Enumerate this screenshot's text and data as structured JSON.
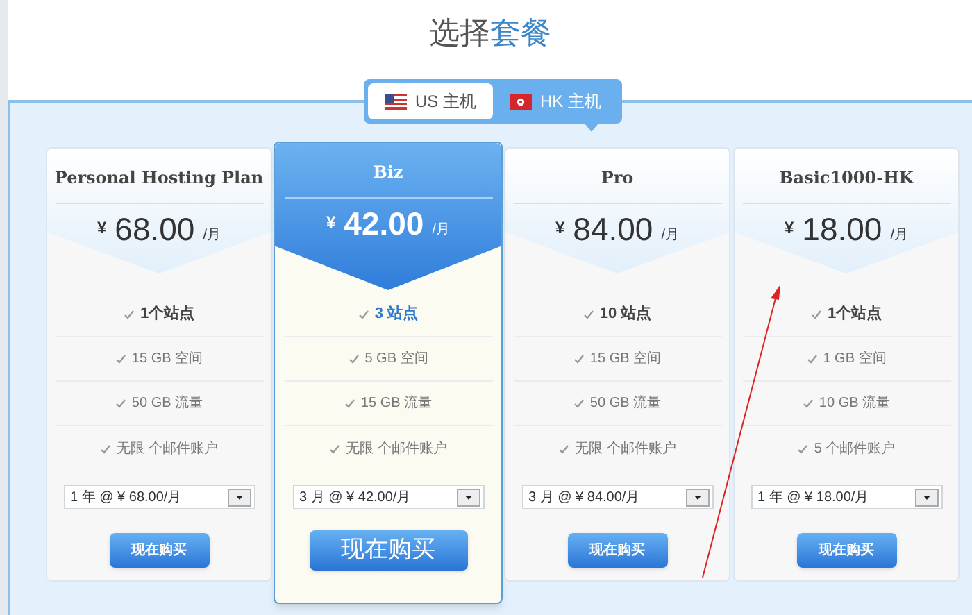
{
  "heading": {
    "plain": "选择",
    "accent": "套餐"
  },
  "tabs": [
    {
      "label": "US 主机",
      "kind": "us",
      "selected": false
    },
    {
      "label": "HK 主机",
      "kind": "hk",
      "selected": true
    }
  ],
  "plans": [
    {
      "name": "Personal Hosting Plan",
      "featured": false,
      "currency": "¥",
      "amount": "68.00",
      "unit": "/月",
      "features": [
        {
          "text": "1个站点",
          "emphasis": true
        },
        {
          "text": "15 GB 空间",
          "emphasis": false
        },
        {
          "text": "50 GB 流量",
          "emphasis": false
        },
        {
          "text": "无限 个邮件账户",
          "emphasis": false
        }
      ],
      "term": "1 年 @ ¥ 68.00/月",
      "button": "现在购买"
    },
    {
      "name": "Biz",
      "featured": true,
      "currency": "¥",
      "amount": "42.00",
      "unit": "/月",
      "features": [
        {
          "text": "3 站点",
          "emphasis": true
        },
        {
          "text": "5 GB 空间",
          "emphasis": false
        },
        {
          "text": "15 GB 流量",
          "emphasis": false
        },
        {
          "text": "无限 个邮件账户",
          "emphasis": false
        }
      ],
      "term": "3 月 @ ¥ 42.00/月",
      "button": "现在购买"
    },
    {
      "name": "Pro",
      "featured": false,
      "currency": "¥",
      "amount": "84.00",
      "unit": "/月",
      "features": [
        {
          "text": "10 站点",
          "emphasis": true
        },
        {
          "text": "15 GB 空间",
          "emphasis": false
        },
        {
          "text": "50 GB 流量",
          "emphasis": false
        },
        {
          "text": "无限 个邮件账户",
          "emphasis": false
        }
      ],
      "term": "3 月 @ ¥ 84.00/月",
      "button": "现在购买"
    },
    {
      "name": "Basic1000-HK",
      "featured": false,
      "currency": "¥",
      "amount": "18.00",
      "unit": "/月",
      "features": [
        {
          "text": "1个站点",
          "emphasis": true
        },
        {
          "text": "1 GB 空间",
          "emphasis": false
        },
        {
          "text": "10 GB 流量",
          "emphasis": false
        },
        {
          "text": "5 个邮件账户",
          "emphasis": false
        }
      ],
      "term": "1 年 @ ¥ 18.00/月",
      "button": "现在购买"
    }
  ]
}
